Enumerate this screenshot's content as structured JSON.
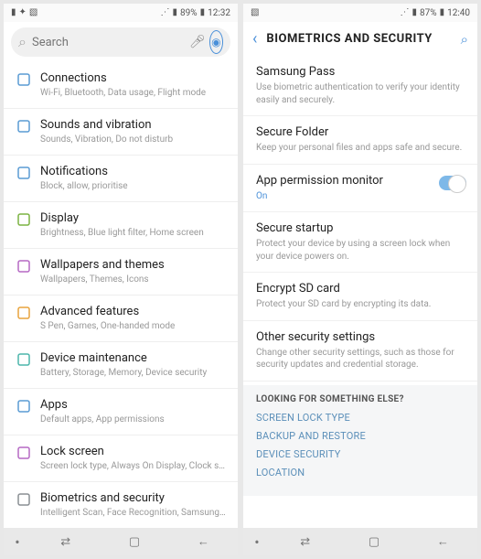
{
  "left": {
    "status": {
      "battery": "89%",
      "time": "12:32"
    },
    "search_placeholder": "Search",
    "items": [
      {
        "icon": "connections-icon",
        "title": "Connections",
        "sub": "Wi-Fi, Bluetooth, Data usage, Flight mode"
      },
      {
        "icon": "sound-icon",
        "title": "Sounds and vibration",
        "sub": "Sounds, Vibration, Do not disturb"
      },
      {
        "icon": "notifications-icon",
        "title": "Notifications",
        "sub": "Block, allow, prioritise"
      },
      {
        "icon": "display-icon",
        "title": "Display",
        "sub": "Brightness, Blue light filter, Home screen"
      },
      {
        "icon": "wallpaper-icon",
        "title": "Wallpapers and themes",
        "sub": "Wallpapers, Themes, Icons"
      },
      {
        "icon": "advanced-icon",
        "title": "Advanced features",
        "sub": "S Pen, Games, One-handed mode"
      },
      {
        "icon": "maintenance-icon",
        "title": "Device maintenance",
        "sub": "Battery, Storage, Memory, Device security"
      },
      {
        "icon": "apps-icon",
        "title": "Apps",
        "sub": "Default apps, App permissions"
      },
      {
        "icon": "lock-icon",
        "title": "Lock screen",
        "sub": "Screen lock type, Always On Display, Clock style"
      },
      {
        "icon": "biometrics-icon",
        "title": "Biometrics and security",
        "sub": "Intelligent Scan, Face Recognition, Samsung P…"
      }
    ]
  },
  "right": {
    "status": {
      "battery": "87%",
      "time": "12:40"
    },
    "header": "BIOMETRICS AND SECURITY",
    "items": [
      {
        "title": "Samsung Pass",
        "sub": "Use biometric authentication to verify your identity easily and securely."
      },
      {
        "title": "Secure Folder",
        "sub": "Keep your personal files and apps safe and secure."
      },
      {
        "title": "App permission monitor",
        "sub": "On",
        "on": true,
        "toggle": true
      },
      {
        "title": "Secure startup",
        "sub": "Protect your device by using a screen lock when your device powers on."
      },
      {
        "title": "Encrypt SD card",
        "sub": "Protect your SD card by encrypting its data."
      },
      {
        "title": "Other security settings",
        "sub": "Change other security settings, such as those for security updates and credential storage."
      }
    ],
    "looking": {
      "header": "LOOKING FOR SOMETHING ELSE?",
      "links": [
        "SCREEN LOCK TYPE",
        "BACKUP AND RESTORE",
        "DEVICE SECURITY",
        "LOCATION"
      ]
    }
  },
  "icon_colors": {
    "connections-icon": "#5a9bd4",
    "sound-icon": "#5a9bd4",
    "notifications-icon": "#5a9bd4",
    "display-icon": "#7cb342",
    "wallpaper-icon": "#b569c4",
    "advanced-icon": "#e8a33d",
    "maintenance-icon": "#4db6ac",
    "apps-icon": "#5a9bd4",
    "lock-icon": "#b569c4",
    "biometrics-icon": "#8a8f94"
  }
}
